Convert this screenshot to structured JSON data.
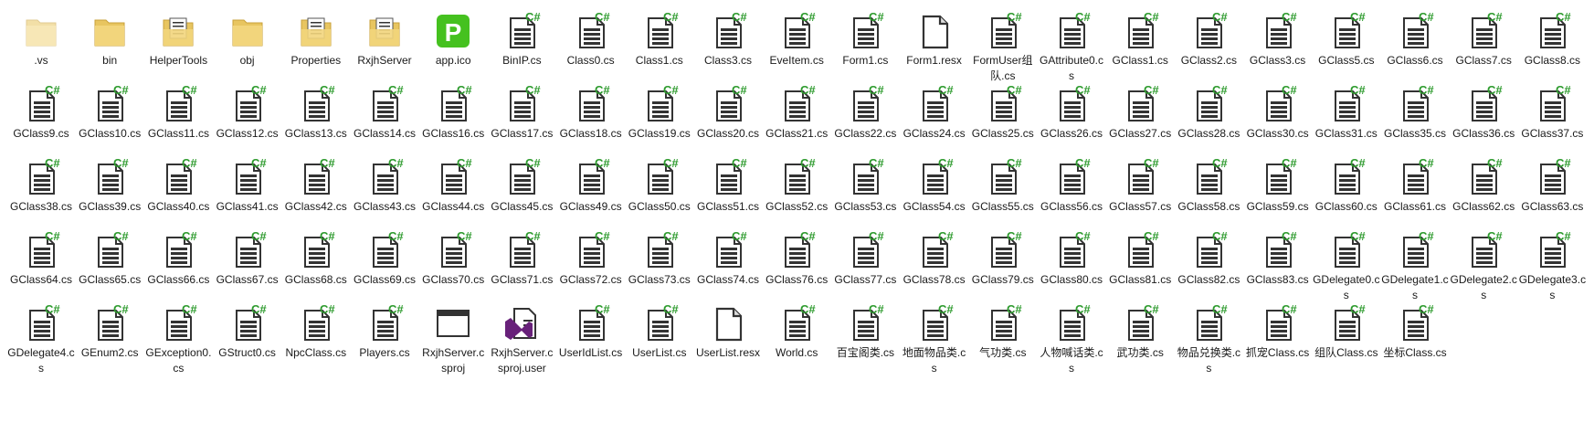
{
  "colors": {
    "csharp_green": "#2e9b2e",
    "folder_yellow": "#e8c560",
    "doc_dark": "#333333"
  },
  "rows": [
    [
      {
        "name": ".vs",
        "type": "folder-dim"
      },
      {
        "name": "bin",
        "type": "folder"
      },
      {
        "name": "HelperTools",
        "type": "folder-doc"
      },
      {
        "name": "obj",
        "type": "folder"
      },
      {
        "name": "Properties",
        "type": "folder-doc"
      },
      {
        "name": "RxjhServer",
        "type": "folder-doc"
      },
      {
        "name": "app.ico",
        "type": "ico"
      },
      {
        "name": "BinIP.cs",
        "type": "cs"
      },
      {
        "name": "Class0.cs",
        "type": "cs"
      },
      {
        "name": "Class1.cs",
        "type": "cs"
      },
      {
        "name": "Class3.cs",
        "type": "cs"
      },
      {
        "name": "EveItem.cs",
        "type": "cs"
      },
      {
        "name": "Form1.cs",
        "type": "cs"
      },
      {
        "name": "Form1.resx",
        "type": "file"
      },
      {
        "name": "FormUser组队.cs",
        "type": "cs"
      },
      {
        "name": "GAttribute0.cs",
        "type": "cs"
      },
      {
        "name": "GClass1.cs",
        "type": "cs"
      },
      {
        "name": "GClass2.cs",
        "type": "cs"
      },
      {
        "name": "GClass3.cs",
        "type": "cs"
      },
      {
        "name": "GClass5.cs",
        "type": "cs"
      },
      {
        "name": "GClass6.cs",
        "type": "cs"
      },
      {
        "name": "GClass7.cs",
        "type": "cs"
      },
      {
        "name": "GClass8.cs",
        "type": "cs"
      }
    ],
    [
      {
        "name": "GClass9.cs",
        "type": "cs"
      },
      {
        "name": "GClass10.cs",
        "type": "cs"
      },
      {
        "name": "GClass11.cs",
        "type": "cs"
      },
      {
        "name": "GClass12.cs",
        "type": "cs"
      },
      {
        "name": "GClass13.cs",
        "type": "cs"
      },
      {
        "name": "GClass14.cs",
        "type": "cs"
      },
      {
        "name": "GClass16.cs",
        "type": "cs"
      },
      {
        "name": "GClass17.cs",
        "type": "cs"
      },
      {
        "name": "GClass18.cs",
        "type": "cs"
      },
      {
        "name": "GClass19.cs",
        "type": "cs"
      },
      {
        "name": "GClass20.cs",
        "type": "cs"
      },
      {
        "name": "GClass21.cs",
        "type": "cs"
      },
      {
        "name": "GClass22.cs",
        "type": "cs"
      },
      {
        "name": "GClass24.cs",
        "type": "cs"
      },
      {
        "name": "GClass25.cs",
        "type": "cs"
      },
      {
        "name": "GClass26.cs",
        "type": "cs"
      },
      {
        "name": "GClass27.cs",
        "type": "cs"
      },
      {
        "name": "GClass28.cs",
        "type": "cs"
      },
      {
        "name": "GClass30.cs",
        "type": "cs"
      },
      {
        "name": "GClass31.cs",
        "type": "cs"
      },
      {
        "name": "GClass35.cs",
        "type": "cs"
      },
      {
        "name": "GClass36.cs",
        "type": "cs"
      },
      {
        "name": "GClass37.cs",
        "type": "cs"
      }
    ],
    [
      {
        "name": "GClass38.cs",
        "type": "cs"
      },
      {
        "name": "GClass39.cs",
        "type": "cs"
      },
      {
        "name": "GClass40.cs",
        "type": "cs"
      },
      {
        "name": "GClass41.cs",
        "type": "cs"
      },
      {
        "name": "GClass42.cs",
        "type": "cs"
      },
      {
        "name": "GClass43.cs",
        "type": "cs"
      },
      {
        "name": "GClass44.cs",
        "type": "cs"
      },
      {
        "name": "GClass45.cs",
        "type": "cs"
      },
      {
        "name": "GClass49.cs",
        "type": "cs"
      },
      {
        "name": "GClass50.cs",
        "type": "cs"
      },
      {
        "name": "GClass51.cs",
        "type": "cs"
      },
      {
        "name": "GClass52.cs",
        "type": "cs"
      },
      {
        "name": "GClass53.cs",
        "type": "cs"
      },
      {
        "name": "GClass54.cs",
        "type": "cs"
      },
      {
        "name": "GClass55.cs",
        "type": "cs"
      },
      {
        "name": "GClass56.cs",
        "type": "cs"
      },
      {
        "name": "GClass57.cs",
        "type": "cs"
      },
      {
        "name": "GClass58.cs",
        "type": "cs"
      },
      {
        "name": "GClass59.cs",
        "type": "cs"
      },
      {
        "name": "GClass60.cs",
        "type": "cs"
      },
      {
        "name": "GClass61.cs",
        "type": "cs"
      },
      {
        "name": "GClass62.cs",
        "type": "cs"
      },
      {
        "name": "GClass63.cs",
        "type": "cs"
      }
    ],
    [
      {
        "name": "GClass64.cs",
        "type": "cs"
      },
      {
        "name": "GClass65.cs",
        "type": "cs"
      },
      {
        "name": "GClass66.cs",
        "type": "cs"
      },
      {
        "name": "GClass67.cs",
        "type": "cs"
      },
      {
        "name": "GClass68.cs",
        "type": "cs"
      },
      {
        "name": "GClass69.cs",
        "type": "cs"
      },
      {
        "name": "GClass70.cs",
        "type": "cs"
      },
      {
        "name": "GClass71.cs",
        "type": "cs"
      },
      {
        "name": "GClass72.cs",
        "type": "cs"
      },
      {
        "name": "GClass73.cs",
        "type": "cs"
      },
      {
        "name": "GClass74.cs",
        "type": "cs"
      },
      {
        "name": "GClass76.cs",
        "type": "cs"
      },
      {
        "name": "GClass77.cs",
        "type": "cs"
      },
      {
        "name": "GClass78.cs",
        "type": "cs"
      },
      {
        "name": "GClass79.cs",
        "type": "cs"
      },
      {
        "name": "GClass80.cs",
        "type": "cs"
      },
      {
        "name": "GClass81.cs",
        "type": "cs"
      },
      {
        "name": "GClass82.cs",
        "type": "cs"
      },
      {
        "name": "GClass83.cs",
        "type": "cs"
      },
      {
        "name": "GDelegate0.cs",
        "type": "cs"
      },
      {
        "name": "GDelegate1.cs",
        "type": "cs"
      },
      {
        "name": "GDelegate2.cs",
        "type": "cs"
      },
      {
        "name": "GDelegate3.cs",
        "type": "cs"
      }
    ],
    [
      {
        "name": "GDelegate4.cs",
        "type": "cs"
      },
      {
        "name": "GEnum2.cs",
        "type": "cs"
      },
      {
        "name": "GException0.cs",
        "type": "cs"
      },
      {
        "name": "GStruct0.cs",
        "type": "cs"
      },
      {
        "name": "NpcClass.cs",
        "type": "cs"
      },
      {
        "name": "Players.cs",
        "type": "cs"
      },
      {
        "name": "RxjhServer.csproj",
        "type": "window"
      },
      {
        "name": "RxjhServer.csproj.user",
        "type": "vs"
      },
      {
        "name": "UserIdList.cs",
        "type": "cs"
      },
      {
        "name": "UserList.cs",
        "type": "cs"
      },
      {
        "name": "UserList.resx",
        "type": "file"
      },
      {
        "name": "World.cs",
        "type": "cs"
      },
      {
        "name": "百宝阁类.cs",
        "type": "cs"
      },
      {
        "name": "地面物品类.cs",
        "type": "cs"
      },
      {
        "name": "气功类.cs",
        "type": "cs"
      },
      {
        "name": "人物喊话类.cs",
        "type": "cs"
      },
      {
        "name": "武功类.cs",
        "type": "cs"
      },
      {
        "name": "物品兑换类.cs",
        "type": "cs"
      },
      {
        "name": "抓宠Class.cs",
        "type": "cs"
      },
      {
        "name": "组队Class.cs",
        "type": "cs"
      },
      {
        "name": "坐标Class.cs",
        "type": "cs"
      }
    ]
  ]
}
